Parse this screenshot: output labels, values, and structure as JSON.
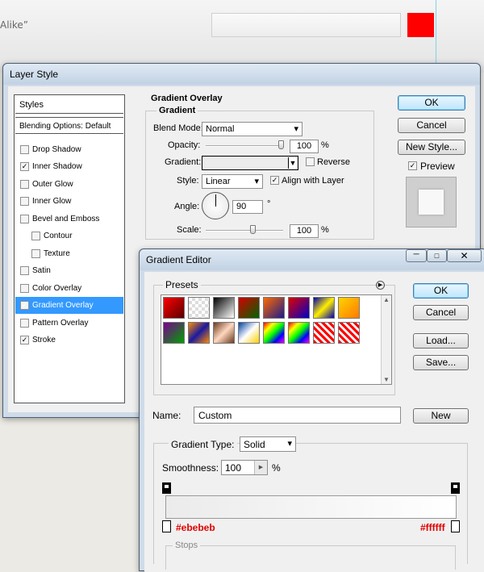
{
  "background": {
    "snippet": "Alike”",
    "swatch_color": "#ff0000"
  },
  "layer_style": {
    "title": "Layer Style",
    "styles_header": "Styles",
    "blending_default": "Blending Options: Default",
    "items": [
      {
        "label": "Drop Shadow",
        "checked": false
      },
      {
        "label": "Inner Shadow",
        "checked": true
      },
      {
        "label": "Outer Glow",
        "checked": false
      },
      {
        "label": "Inner Glow",
        "checked": false
      },
      {
        "label": "Bevel and Emboss",
        "checked": false
      },
      {
        "label": "Contour",
        "checked": false
      },
      {
        "label": "Texture",
        "checked": false
      },
      {
        "label": "Satin",
        "checked": false
      },
      {
        "label": "Color Overlay",
        "checked": false
      },
      {
        "label": "Gradient Overlay",
        "checked": true
      },
      {
        "label": "Pattern Overlay",
        "checked": false
      },
      {
        "label": "Stroke",
        "checked": true
      }
    ],
    "section_title": "Gradient Overlay",
    "group_title": "Gradient",
    "blend_mode_label": "Blend Mode:",
    "blend_mode_value": "Normal",
    "opacity_label": "Opacity:",
    "opacity_value": "100",
    "opacity_unit": "%",
    "gradient_label": "Gradient:",
    "reverse_label": "Reverse",
    "style_label": "Style:",
    "style_value": "Linear",
    "align_label": "Align with Layer",
    "angle_label": "Angle:",
    "angle_value": "90",
    "angle_unit": "°",
    "scale_label": "Scale:",
    "scale_value": "100",
    "scale_unit": "%",
    "ok": "OK",
    "cancel": "Cancel",
    "new_style": "New Style...",
    "preview": "Preview"
  },
  "gradient_editor": {
    "title": "Gradient Editor",
    "presets_label": "Presets",
    "ok": "OK",
    "cancel": "Cancel",
    "load": "Load...",
    "save": "Save...",
    "name_label": "Name:",
    "name_value": "Custom",
    "new": "New",
    "type_label": "Gradient Type:",
    "type_value": "Solid",
    "smoothness_label": "Smoothness:",
    "smoothness_value": "100",
    "smoothness_unit": "%",
    "left_stop_color": "#ebebeb",
    "right_stop_color": "#ffffff",
    "stops_label": "Stops",
    "presets": [
      "linear-gradient(135deg,#ff0000,#5a0000)",
      "repeating-conic-gradient(#ddd 0 25%,#fff 0 50%) 0 0/8px 8px",
      "linear-gradient(135deg,#000,#fff)",
      "linear-gradient(135deg,#d40000,#006400)",
      "linear-gradient(135deg,#ff6a00,#1a1a8c)",
      "linear-gradient(135deg,#e00000,#0000c8)",
      "linear-gradient(135deg,#0000b0,#ffee00,#0000b0)",
      "linear-gradient(135deg,#ffd400,#ff7a00)",
      "linear-gradient(135deg,#7a0090,#00a000)",
      "linear-gradient(135deg,#ff8a00,#1a1aa0,#ff8a00)",
      "linear-gradient(135deg,#6b3a1e,#ffd8c0,#6b3a1e)",
      "linear-gradient(135deg,#0040a0,#fff,#ffd000)",
      "linear-gradient(135deg,#ff0000,#ffff00,#00ff00,#0000ff,#ff00ff)",
      "linear-gradient(135deg,#ff0000,#ffff00,#00ff00,#0000ff,#ff00ff)",
      "repeating-linear-gradient(45deg,#ff0000 0 3px,#ffffff 3px 6px)",
      "repeating-linear-gradient(45deg,#ff0000 0 3px,#ffffff 3px 6px)"
    ]
  }
}
